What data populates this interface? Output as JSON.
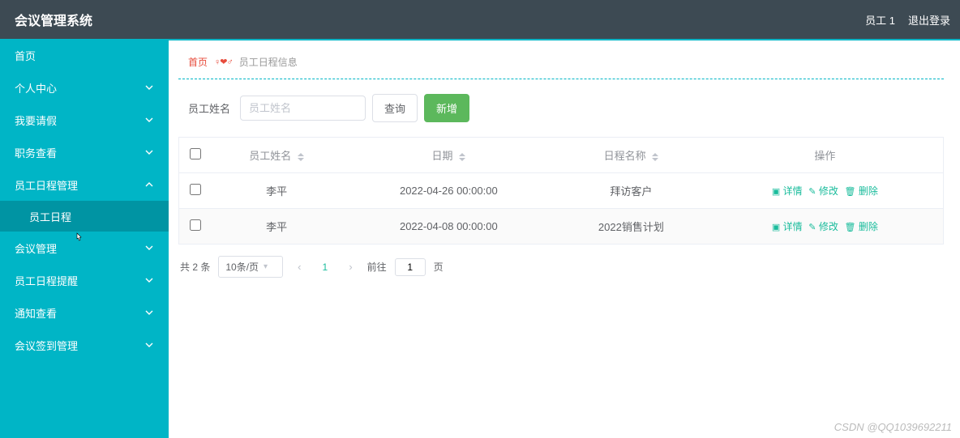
{
  "header": {
    "title": "会议管理系统",
    "user": "员工 1",
    "logout": "退出登录"
  },
  "sidebar": {
    "items": [
      {
        "label": "首页",
        "expandable": false
      },
      {
        "label": "个人中心",
        "expandable": true
      },
      {
        "label": "我要请假",
        "expandable": true
      },
      {
        "label": "职务查看",
        "expandable": true
      },
      {
        "label": "员工日程管理",
        "expandable": true,
        "expanded": true,
        "children": [
          {
            "label": "员工日程"
          }
        ]
      },
      {
        "label": "会议管理",
        "expandable": true
      },
      {
        "label": "员工日程提醒",
        "expandable": true
      },
      {
        "label": "通知查看",
        "expandable": true
      },
      {
        "label": "会议签到管理",
        "expandable": true
      }
    ]
  },
  "breadcrumb": {
    "home": "首页",
    "separator": "♀❤♂",
    "current": "员工日程信息"
  },
  "toolbar": {
    "name_label": "员工姓名",
    "name_placeholder": "员工姓名",
    "search_label": "查询",
    "add_label": "新增"
  },
  "table": {
    "columns": {
      "name": "员工姓名",
      "date": "日期",
      "schedule_name": "日程名称",
      "action": "操作"
    },
    "rows": [
      {
        "name": "李平",
        "date": "2022-04-26 00:00:00",
        "schedule_name": "拜访客户"
      },
      {
        "name": "李平",
        "date": "2022-04-08 00:00:00",
        "schedule_name": "2022销售计划"
      }
    ],
    "actions": {
      "detail": "详情",
      "edit": "修改",
      "delete": "删除"
    }
  },
  "pagination": {
    "total_text": "共 2 条",
    "page_size": "10条/页",
    "current_page": "1",
    "goto_prefix": "前往",
    "goto_value": "1",
    "goto_suffix": "页"
  },
  "watermark": "CSDN @QQ1039692211"
}
